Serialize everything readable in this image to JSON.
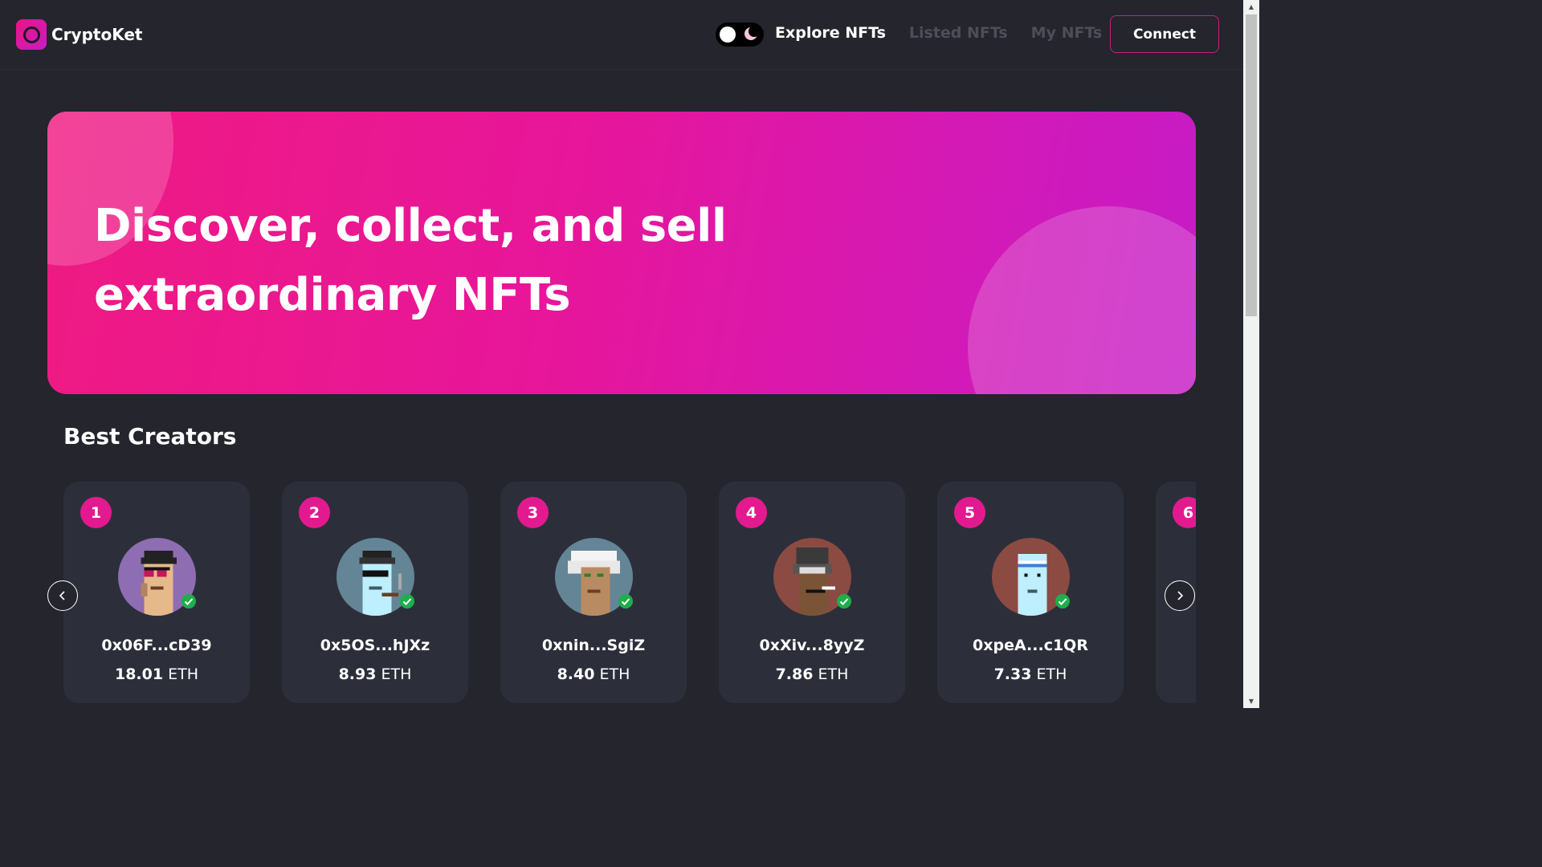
{
  "brand": {
    "name": "CryptoKet"
  },
  "nav": {
    "links": [
      {
        "label": "Explore NFTs",
        "active": true
      },
      {
        "label": "Listed NFTs",
        "active": false
      },
      {
        "label": "My NFTs",
        "active": false
      }
    ],
    "connect_label": "Connect",
    "theme_toggle": {
      "mode": "dark",
      "icon": "moon-icon"
    }
  },
  "hero": {
    "title_line1": "Discover, collect, and sell",
    "title_line2": "extraordinary NFTs"
  },
  "best_creators": {
    "title": "Best Creators",
    "creators": [
      {
        "rank": "1",
        "address": "0x06F...cD39",
        "amount": "18.01",
        "unit": "ETH"
      },
      {
        "rank": "2",
        "address": "0x5OS...hJXz",
        "amount": "8.93",
        "unit": "ETH"
      },
      {
        "rank": "3",
        "address": "0xnin...SgiZ",
        "amount": "8.40",
        "unit": "ETH"
      },
      {
        "rank": "4",
        "address": "0xXiv...8yyZ",
        "amount": "7.86",
        "unit": "ETH"
      },
      {
        "rank": "5",
        "address": "0xpeA...c1QR",
        "amount": "7.33",
        "unit": "ETH"
      },
      {
        "rank": "6",
        "address": "",
        "amount": "",
        "unit": ""
      }
    ]
  },
  "colors": {
    "background": "#24252d",
    "card": "#2c2f3a",
    "accent_pink": "#e31a8f",
    "accent_purple": "#c91cc3",
    "verified_green": "#1fae4b"
  }
}
